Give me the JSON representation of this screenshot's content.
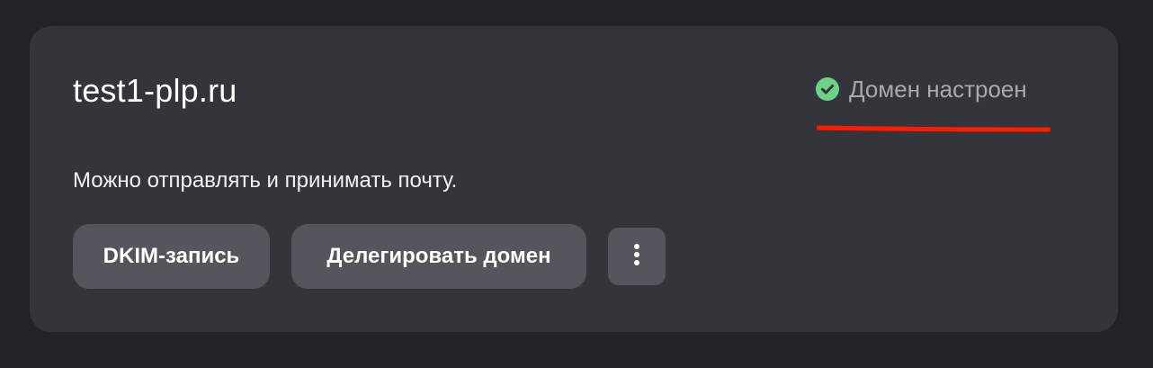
{
  "card": {
    "domain": "test1-plp.ru",
    "status": {
      "text": "Домен настроен",
      "icon": "check-circle-icon",
      "icon_color": "#6fd08c",
      "underline_color": "#ff1a00"
    },
    "description": "Можно отправлять и принимать почту.",
    "buttons": {
      "dkim_label": "DKIM-запись",
      "delegate_label": "Делегировать домен",
      "more_icon": "more-vertical-icon"
    }
  },
  "colors": {
    "page_bg": "#232327",
    "card_bg": "#34343b",
    "button_bg": "#55555d"
  }
}
